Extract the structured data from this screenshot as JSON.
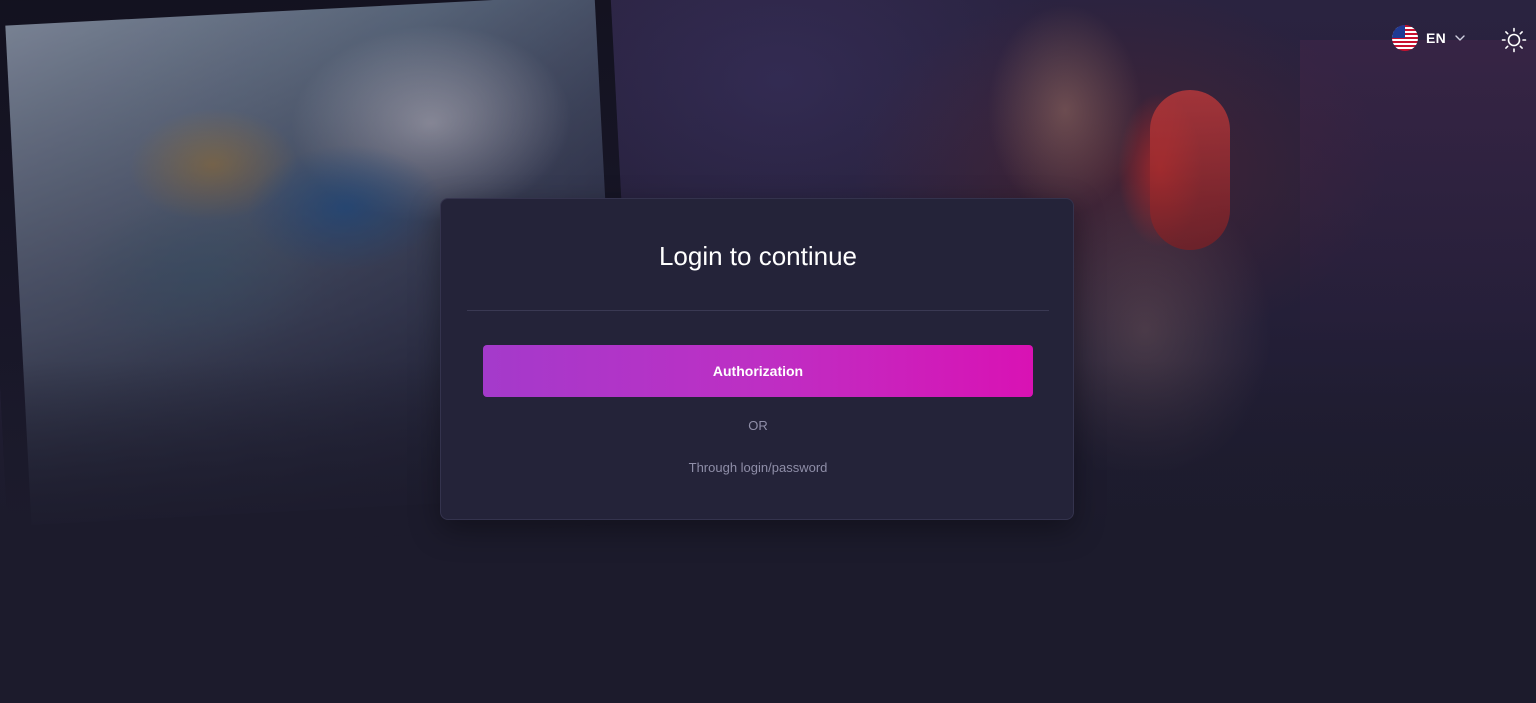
{
  "header": {
    "language": {
      "flag_icon": "us-flag-icon",
      "code": "EN",
      "dropdown_icon": "chevron-down-icon"
    },
    "theme_toggle_icon": "sun-icon"
  },
  "login_card": {
    "title": "Login to continue",
    "authorization_button_label": "Authorization",
    "separator_text": "OR",
    "alt_login_link": "Through login/password"
  },
  "colors": {
    "page_background": "#1c1b2c",
    "card_background": "#242339",
    "button_gradient_start": "#a43acb",
    "button_gradient_end": "#d912b4",
    "muted_text": "#8f8ea8"
  }
}
